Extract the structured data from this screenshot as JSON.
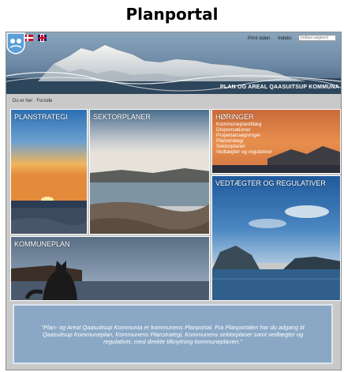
{
  "page_caption": "Planportal",
  "header": {
    "links": {
      "print": "Print siden",
      "index": "Indeks"
    },
    "search": {
      "placeholder": "Indtast søgeord"
    },
    "municipality_title": "PLAN OG AREAL QAASUITSUP KOMMUNA",
    "flags": [
      "greenland-flag",
      "denmark-flag",
      "uk-flag"
    ]
  },
  "breadcrumb": {
    "label": "Du er her:",
    "current": "Forside"
  },
  "tiles": {
    "planstrategi": {
      "title": "PLANSTRATEGI"
    },
    "sektorplaner": {
      "title": "SEKTORPLANER"
    },
    "horinger": {
      "title": "HØRINGER",
      "items": [
        "Kommuneplantillæg",
        "Dispensationer",
        "Projektansøgninger",
        "Planstrategi",
        "Sektorplaner",
        "Vedtægter og regulativer"
      ]
    },
    "vedtaegter": {
      "title": "VEDTÆGTER OG REGULATIVER"
    },
    "kommuneplan": {
      "title": "KOMMUNEPLAN"
    }
  },
  "intro_text": "\"Plan- og Areal Qaasuitsup Kommunia er kommunens Planportal. Fra Planportalen har du adgang til Qaasuitsup Kommuneplan, Kommunens Planstrategi, Kommunens sektorplaner samt vedtægter og regulativer, med direkte tilknytning kommuneplanen.\"",
  "colors": {
    "frame_bg": "#c9c9c9",
    "quote_bg": "#8aa8c6",
    "header_sky": "#8aa5bd"
  }
}
